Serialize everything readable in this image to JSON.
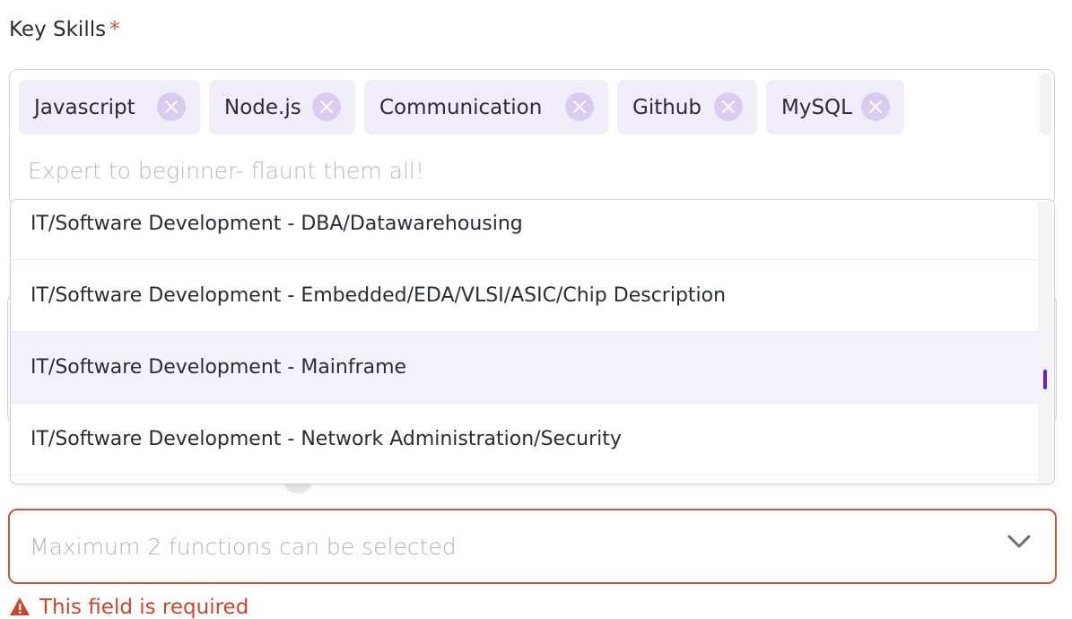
{
  "key_skills": {
    "label": "Key Skills",
    "required_marker": "*",
    "chips": [
      {
        "label": "Javascript"
      },
      {
        "label": "Node.js"
      },
      {
        "label": "Communication"
      },
      {
        "label": "Github"
      },
      {
        "label": "MySQL"
      }
    ],
    "input_placeholder": "Expert to beginner- flaunt them all!",
    "input_value": ""
  },
  "dropdown": {
    "options": [
      {
        "label": "IT/Software Development - DBA/Datawarehousing"
      },
      {
        "label": "IT/Software Development - Embedded/EDA/VLSI/ASIC/Chip Description"
      },
      {
        "label": "IT/Software Development - Mainframe",
        "highlighted": true
      },
      {
        "label": "IT/Software Development - Network Administration/Security"
      }
    ]
  },
  "functions": {
    "placeholder": "Maximum 2 functions can be selected",
    "error_text": "This field is required"
  },
  "colors": {
    "chip_bg": "#f1edf8",
    "chip_remove": "#dccbf0",
    "required": "#e0492e",
    "error": "#d0442a",
    "scroll_accent": "#6a1fd0"
  }
}
